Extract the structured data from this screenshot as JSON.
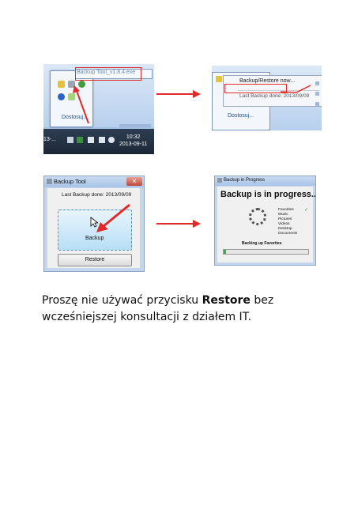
{
  "panel1": {
    "tooltip": "Backup Tool_v1.8.4.exe",
    "customize_link": "Dostosuj...",
    "taskbar_left": "13-...",
    "clock_time": "10:32",
    "clock_date": "2013-09-11"
  },
  "panel2": {
    "menu_item": "Backup/Restore now...",
    "last_backup": "Last Backup done: 2013/09/09",
    "customize_link": "Dostosuj..."
  },
  "panel3": {
    "window_title": "Backup Tool",
    "close_glyph": "✕",
    "last_backup": "Last Backup done: 2013/09/09",
    "backup_label": "Backup",
    "restore_label": "Restore"
  },
  "panel4": {
    "window_title": "Backup in Progress",
    "heading": "Backup is in progress...",
    "items": [
      "Favorites",
      "Music",
      "Pictures",
      "Videos",
      "Desktop",
      "Documents"
    ],
    "check_glyph": "✓",
    "status": "Backing up Favorites",
    "progress_fraction": 0.03
  },
  "caption": {
    "part1": "Proszę nie używać przycisku ",
    "bold": "Restore",
    "part2": " bez wcześniejszej konsultacji z działem IT."
  },
  "colors": {
    "annotation": "#e12b2b",
    "link": "#1d4f98",
    "progress": "#2fb24a"
  }
}
